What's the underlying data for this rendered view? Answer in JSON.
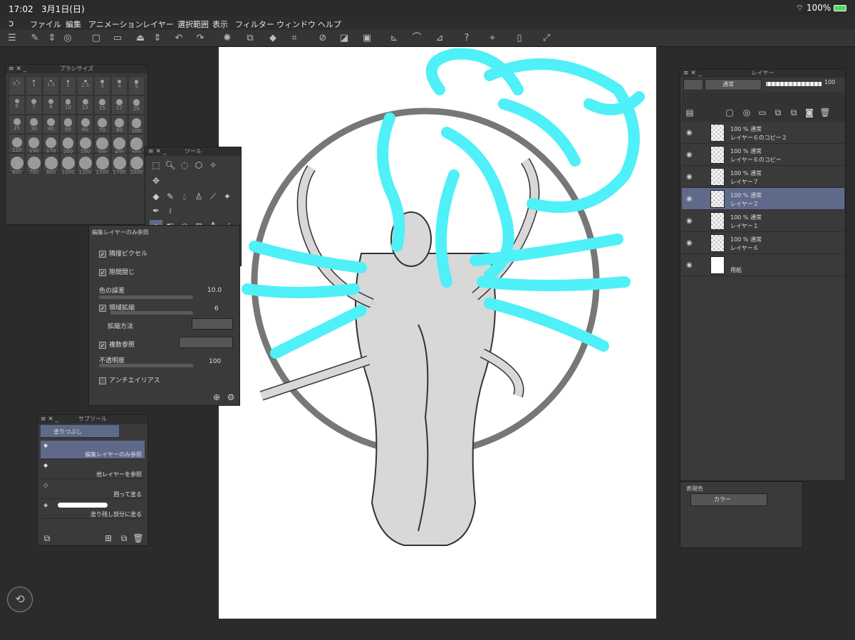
{
  "status": {
    "time": "17:02",
    "date": "3月1日(日)",
    "battery": "100%"
  },
  "menu": [
    "ファイル",
    "編集",
    "アニメーション",
    "レイヤー",
    "選択範囲",
    "表示",
    "フィルター",
    "ウィンドウ",
    "ヘルプ"
  ],
  "brush_size": {
    "title": "ブラシサイズ",
    "sizes": [
      "0.7",
      "1",
      "1.5",
      "2",
      "2.5",
      "3",
      "4",
      "5",
      "6",
      "7",
      "8",
      "10",
      "12",
      "15",
      "17",
      "20",
      "25",
      "30",
      "40",
      "50",
      "60",
      "70",
      "80",
      "100",
      "120",
      "150",
      "170",
      "200",
      "250",
      "300",
      "400",
      "500",
      "600",
      "700",
      "800",
      "1000",
      "1200",
      "1500",
      "1700",
      "2000"
    ]
  },
  "tool_panel": {
    "title": "ツール",
    "main_color": "#4fe8f5",
    "sub_color": "#cccccc"
  },
  "tool_property": {
    "header": "編集レイヤーのみ参照",
    "adjacent_pixel": "隣接ピクセル",
    "close_gap": "隙間閉じ",
    "color_margin_label": "色の誤差",
    "color_margin_value": "10.0",
    "area_scaling": "領域拡縮",
    "area_scaling_value": "6",
    "scaling_method": "拡縮方法",
    "multi_refer": "複数参照",
    "opacity_label": "不透明度",
    "opacity_value": "100",
    "antialias": "アンチエイリアス"
  },
  "sub_tool": {
    "title": "サブツール",
    "group": "塗りつぶし",
    "items": [
      "編集レイヤーのみ参照",
      "他レイヤーを参照",
      "囲って塗る",
      "塗り残し部分に塗る"
    ]
  },
  "layers": {
    "title": "レイヤー",
    "blend_mode": "通常",
    "opacity": "100",
    "items": [
      {
        "percent": "100 %",
        "mode": "通常",
        "name": "レイヤー６のコピー２"
      },
      {
        "percent": "100 %",
        "mode": "通常",
        "name": "レイヤー６のコピー"
      },
      {
        "percent": "100 %",
        "mode": "通常",
        "name": "レイヤー７"
      },
      {
        "percent": "100 %",
        "mode": "通常",
        "name": "レイヤー２"
      },
      {
        "percent": "100 %",
        "mode": "通常",
        "name": "レイヤー１"
      },
      {
        "percent": "100 %",
        "mode": "通常",
        "name": "レイヤー６"
      },
      {
        "percent": "",
        "mode": "",
        "name": "用紙"
      }
    ]
  },
  "color_expression": {
    "title": "表現色",
    "value": "カラー"
  },
  "colors": {
    "hair": "#4ff0f7",
    "accent": "#5f6a8a"
  }
}
